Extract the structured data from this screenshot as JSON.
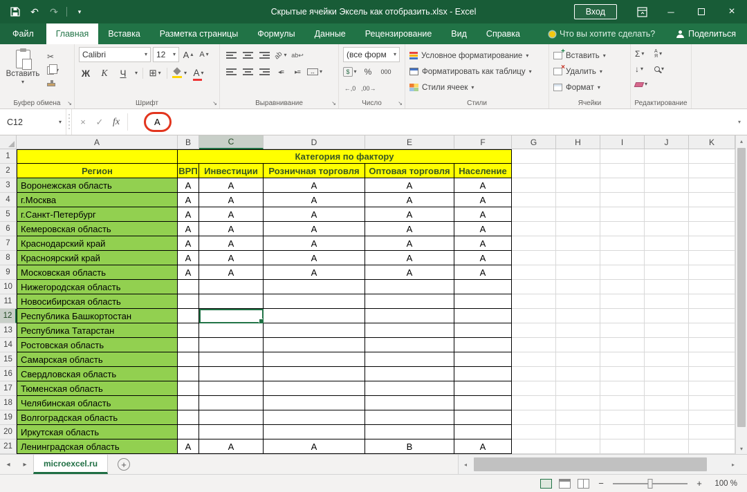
{
  "titlebar": {
    "title": "Скрытые ячейки Эксель как отобразить.xlsx -  Excel",
    "signin_label": "Вход"
  },
  "ribbon_tabs": {
    "file_label": "Файл",
    "tabs": [
      "Главная",
      "Вставка",
      "Разметка страницы",
      "Формулы",
      "Данные",
      "Рецензирование",
      "Вид",
      "Справка"
    ],
    "active": "Главная",
    "search_hint": "Что вы хотите сделать?",
    "share_label": "Поделиться"
  },
  "ribbon": {
    "clipboard": {
      "group_label": "Буфер обмена",
      "paste_label": "Вставить"
    },
    "font": {
      "group_label": "Шрифт",
      "font_name": "Calibri",
      "font_size": "12",
      "bold": "Ж",
      "italic": "К",
      "underline": "Ч",
      "grow": "А",
      "shrink": "А",
      "color_letter": "А"
    },
    "alignment": {
      "group_label": "Выравнивание"
    },
    "number": {
      "group_label": "Число",
      "format_value": "(все форм",
      "percent": "%",
      "thousands": "000",
      "money": "$",
      "inc_decimal": "←,0",
      "dec_decimal": ",00→"
    },
    "styles": {
      "group_label": "Стили",
      "items": [
        "Условное форматирование",
        "Форматировать как таблицу",
        "Стили ячеек"
      ]
    },
    "cells": {
      "group_label": "Ячейки",
      "items": [
        "Вставить",
        "Удалить",
        "Формат"
      ]
    },
    "editing": {
      "group_label": "Редактирование",
      "sort_top": "А",
      "sort_bottom": "Я"
    }
  },
  "formula_bar": {
    "name_box": "C12",
    "fx": "fx",
    "value": "А"
  },
  "grid": {
    "column_headers": [
      "A",
      "B",
      "C",
      "D",
      "E",
      "F",
      "G",
      "H",
      "I",
      "J",
      "K"
    ],
    "selected_column": "C",
    "selected_row": 12,
    "selected_cell": "C12",
    "merged_title": "Категория по фактору",
    "region_header": "Регион",
    "data_headers": [
      "ВРП",
      "Инвестиции",
      "Розничная торговля",
      "Оптовая торговля",
      "Население"
    ],
    "rows": [
      {
        "n": 3,
        "region": "Воронежская область",
        "values": [
          "А",
          "А",
          "А",
          "А",
          "А"
        ]
      },
      {
        "n": 4,
        "region": "г.Москва",
        "values": [
          "А",
          "А",
          "А",
          "А",
          "А"
        ]
      },
      {
        "n": 5,
        "region": "г.Санкт-Петербург",
        "values": [
          "А",
          "А",
          "А",
          "А",
          "А"
        ]
      },
      {
        "n": 6,
        "region": "Кемеровская область",
        "values": [
          "А",
          "А",
          "А",
          "А",
          "А"
        ]
      },
      {
        "n": 7,
        "region": "Краснодарский край",
        "values": [
          "А",
          "А",
          "А",
          "А",
          "А"
        ]
      },
      {
        "n": 8,
        "region": "Красноярский край",
        "values": [
          "А",
          "А",
          "А",
          "А",
          "А"
        ]
      },
      {
        "n": 9,
        "region": "Московская область",
        "values": [
          "А",
          "А",
          "А",
          "А",
          "А"
        ]
      },
      {
        "n": 10,
        "region": "Нижегородская область",
        "values": [
          "",
          "",
          "",
          "",
          ""
        ]
      },
      {
        "n": 11,
        "region": "Новосибирская область",
        "values": [
          "",
          "",
          "",
          "",
          ""
        ]
      },
      {
        "n": 12,
        "region": "Республика Башкортостан",
        "values": [
          "",
          "",
          "",
          "",
          ""
        ]
      },
      {
        "n": 13,
        "region": "Республика Татарстан",
        "values": [
          "",
          "",
          "",
          "",
          ""
        ]
      },
      {
        "n": 14,
        "region": "Ростовская область",
        "values": [
          "",
          "",
          "",
          "",
          ""
        ]
      },
      {
        "n": 15,
        "region": "Самарская область",
        "values": [
          "",
          "",
          "",
          "",
          ""
        ]
      },
      {
        "n": 16,
        "region": "Свердловская область",
        "values": [
          "",
          "",
          "",
          "",
          ""
        ]
      },
      {
        "n": 17,
        "region": "Тюменская область",
        "values": [
          "",
          "",
          "",
          "",
          ""
        ]
      },
      {
        "n": 18,
        "region": "Челябинская область",
        "values": [
          "",
          "",
          "",
          "",
          ""
        ]
      },
      {
        "n": 19,
        "region": "Волгоградская область",
        "values": [
          "",
          "",
          "",
          "",
          ""
        ]
      },
      {
        "n": 20,
        "region": "Иркутская область",
        "values": [
          "",
          "",
          "",
          "",
          ""
        ]
      },
      {
        "n": 21,
        "region": "Ленинградская область",
        "values": [
          "А",
          "А",
          "А",
          "В",
          "А"
        ]
      }
    ]
  },
  "sheet_bar": {
    "tab_label": "microexcel.ru"
  },
  "status_bar": {
    "zoom_label": "100 %",
    "minus": "−",
    "plus": "+"
  },
  "colors": {
    "accent_green": "#217346",
    "titlebar_green": "#185C37",
    "cell_green": "#92D050",
    "cell_yellow": "#FFFF00",
    "header_text_green": "#375623",
    "annotation_red": "#E2351E"
  },
  "icons": {
    "caret": "▾",
    "caret_up": "▴",
    "undo": "↶",
    "redo": "↷",
    "close": "×",
    "minimize": "─",
    "cut": "✂",
    "check": "✓",
    "cancel": "×",
    "sum": "Σ",
    "fill_down": "↓",
    "borders": "⊞",
    "left_tri": "◂",
    "right_tri": "▸",
    "up_tri": "▴",
    "down_tri": "▾",
    "launcher": "↘",
    "ab": "ab",
    "wrap": "ab↩",
    "merge_arrows": "↔",
    "indent_dec": "◂≡",
    "indent_inc": "▸≡",
    "plus": "+"
  }
}
